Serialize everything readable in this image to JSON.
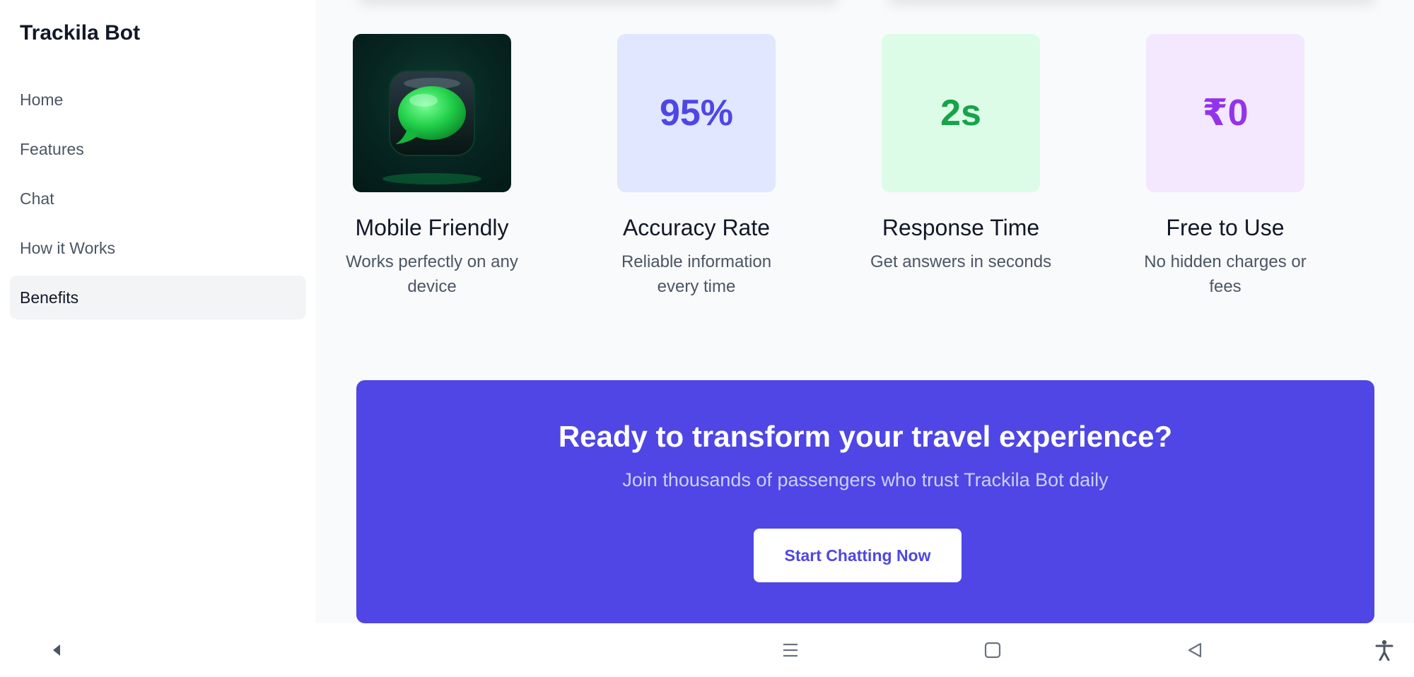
{
  "sidebar": {
    "brand": "Trackila Bot",
    "items": [
      {
        "label": "Home"
      },
      {
        "label": "Features"
      },
      {
        "label": "Chat"
      },
      {
        "label": "How it Works"
      },
      {
        "label": "Benefits"
      }
    ],
    "active_item": "Benefits"
  },
  "benefits": [
    {
      "icon": "chat-bubble-icon",
      "title": "Mobile Friendly",
      "desc": "Works perfectly on any device"
    },
    {
      "stat": "95%",
      "title": "Accuracy Rate",
      "desc": "Reliable information every time",
      "stat_color": "#4f46e5",
      "tile_color": "#e0e7ff"
    },
    {
      "stat": "2s",
      "title": "Response Time",
      "desc": "Get answers in seconds",
      "stat_color": "#16a34a",
      "tile_color": "#dcfce7"
    },
    {
      "stat": "₹0",
      "title": "Free to Use",
      "desc": "No hidden charges or fees",
      "stat_color": "#9333ea",
      "tile_color": "#f3e8ff"
    }
  ],
  "cta": {
    "title": "Ready to transform your travel experience?",
    "subtitle": "Join thousands of passengers who trust Trackila Bot daily",
    "button_label": "Start Chatting Now",
    "background": "#4f46e5"
  },
  "system_bar": {
    "icons": [
      "back-triangle-icon",
      "recents-icon",
      "home-square-icon",
      "back-icon",
      "accessibility-icon"
    ]
  }
}
